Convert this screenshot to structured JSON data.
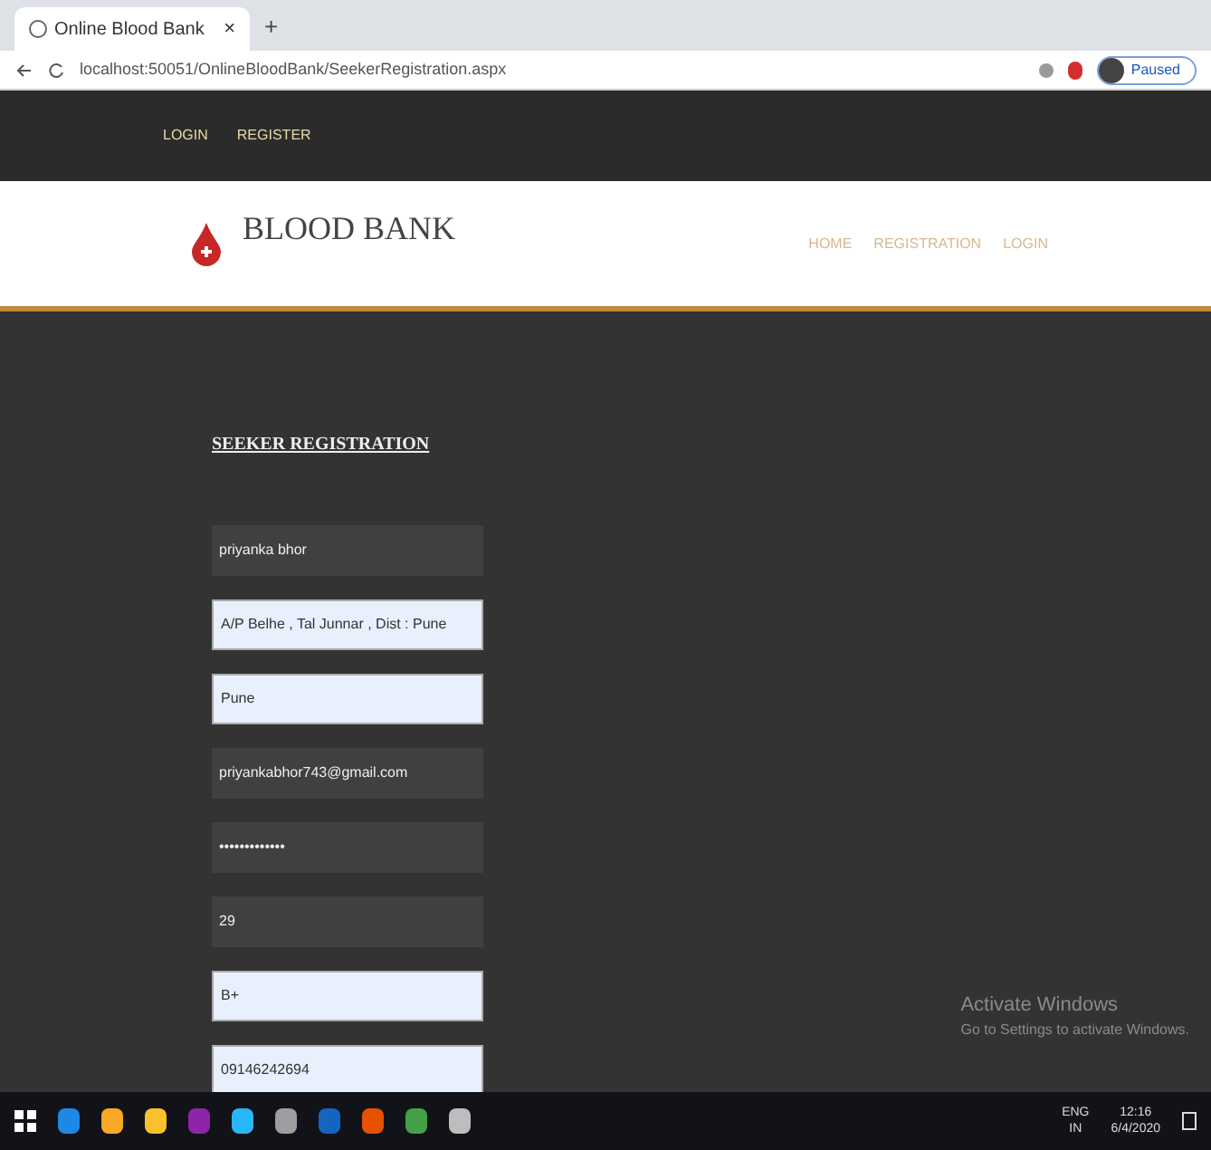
{
  "browser": {
    "tab_title": "Online Blood Bank",
    "tab_close": "×",
    "new_tab": "+",
    "url": "localhost:50051/OnlineBloodBank/SeekerRegistration.aspx",
    "profile": "Paused"
  },
  "top_bar": {
    "links": [
      {
        "label": "LOGIN"
      },
      {
        "label": "REGISTER"
      }
    ]
  },
  "header": {
    "logo": "BLOOD BANK",
    "nav": [
      {
        "label": "HOME"
      },
      {
        "label": "REGISTRATION"
      },
      {
        "label": "LOGIN"
      }
    ]
  },
  "form": {
    "heading": "SEEKER REGISTRATION",
    "fields": [
      {
        "value": "priyanka bhor",
        "autofilled": false
      },
      {
        "value": "A/P Belhe , Tal Junnar , Dist : Pune",
        "autofilled": true
      },
      {
        "value": "Pune",
        "autofilled": true
      },
      {
        "value": "priyankabhor743@gmail.com",
        "autofilled": false
      },
      {
        "value": "•••••••••••••",
        "autofilled": false
      },
      {
        "value": "29",
        "autofilled": false
      },
      {
        "value": "B+",
        "autofilled": true
      },
      {
        "value": "09146242694",
        "autofilled": true
      }
    ]
  },
  "watermark_notice": {
    "title": "Activate Windows",
    "text": "Go to Settings to activate Windows."
  },
  "taskbar": {
    "language": "ENG",
    "region": "IN",
    "time": "12:16",
    "date": "6/4/2020"
  }
}
